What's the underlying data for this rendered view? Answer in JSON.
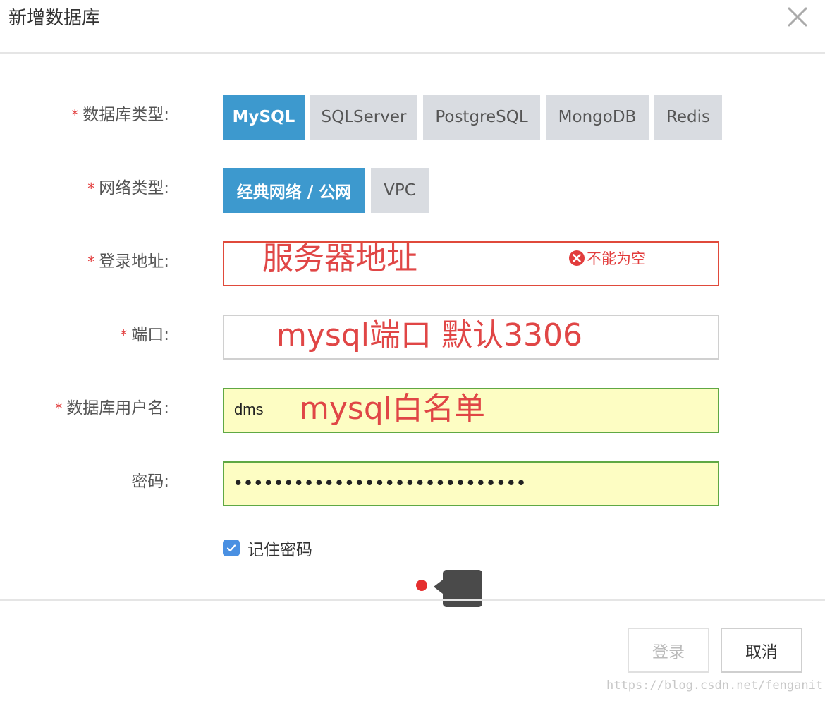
{
  "dialog": {
    "title": "新增数据库",
    "close_icon": "close-icon"
  },
  "form": {
    "db_type": {
      "required": "*",
      "label": "数据库类型:",
      "options": [
        "MySQL",
        "SQLServer",
        "PostgreSQL",
        "MongoDB",
        "Redis"
      ],
      "selected": "MySQL"
    },
    "network_type": {
      "required": "*",
      "label": "网络类型:",
      "options": [
        "经典网络 / 公网",
        "VPC"
      ],
      "selected": "经典网络 / 公网"
    },
    "address": {
      "required": "*",
      "label": "登录地址:",
      "value": "",
      "error": "不能为空",
      "error_icon": "error-circle-icon",
      "annotation": "服务器地址"
    },
    "port": {
      "required": "*",
      "label": "端口:",
      "value": "",
      "annotation": "mysql端口 默认3306"
    },
    "username": {
      "required": "*",
      "label": "数据库用户名:",
      "value": "dms",
      "annotation": "mysql白名单"
    },
    "password": {
      "label": "密码:",
      "value": "•••••••••••••••••••••••••••••"
    },
    "remember": {
      "label": "记住密码",
      "checked": true
    }
  },
  "footer": {
    "login_label": "登录",
    "cancel_label": "取消"
  },
  "watermark": "https://blog.csdn.net/fenganit",
  "colors": {
    "accent": "#3d99ce",
    "error": "#e23c3c",
    "valid_border": "#5fa844",
    "autofill_bg": "#fdfdc3",
    "annotation": "#e04646"
  }
}
